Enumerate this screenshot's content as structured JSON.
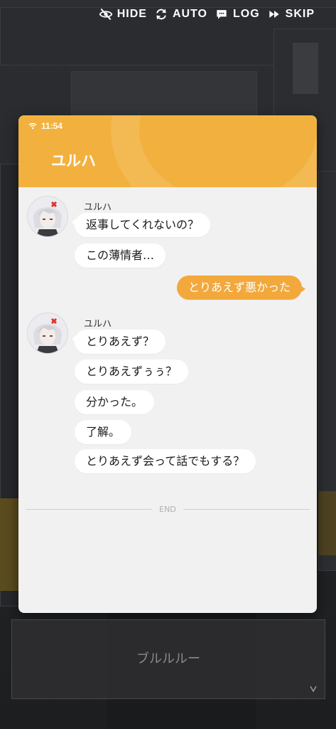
{
  "menu": {
    "hide": "HIDE",
    "auto": "AUTO",
    "log": "LOG",
    "skip": "SKIP"
  },
  "phone": {
    "time": "11:54",
    "contact": "ユルハ",
    "messages": [
      {
        "sender": "ユルハ",
        "texts": [
          "返事してくれないの？",
          "この薄情者…"
        ]
      },
      {
        "outgoing": "とりあえず悪かった"
      },
      {
        "sender": "ユルハ",
        "texts": [
          "とりあえず？",
          "とりあえずぅぅ？",
          "分かった。",
          "了解。",
          "とりあえず会って話でもする？"
        ]
      }
    ],
    "end_label": "END"
  },
  "dialogue": {
    "text": "ブルルルー"
  }
}
